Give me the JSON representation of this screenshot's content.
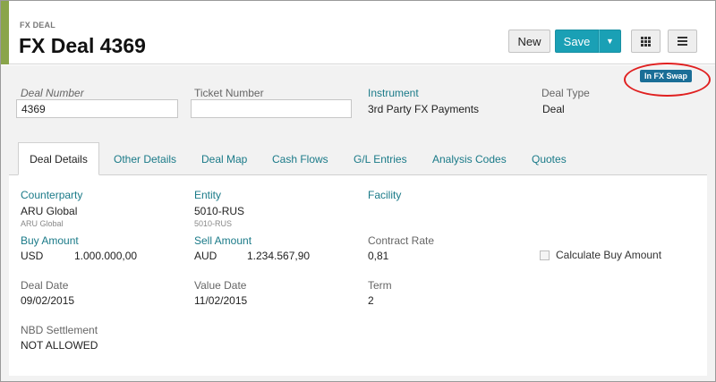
{
  "header": {
    "eyebrow": "FX DEAL",
    "title": "FX Deal 4369",
    "new_label": "New",
    "save_label": "Save"
  },
  "badge": "In FX Swap",
  "top_fields": {
    "deal_number": {
      "label": "Deal Number",
      "value": "4369"
    },
    "ticket_number": {
      "label": "Ticket Number",
      "value": ""
    },
    "instrument": {
      "label": "Instrument",
      "value": "3rd Party FX Payments"
    },
    "deal_type": {
      "label": "Deal Type",
      "value": "Deal"
    }
  },
  "tabs": [
    "Deal Details",
    "Other Details",
    "Deal Map",
    "Cash Flows",
    "G/L Entries",
    "Analysis Codes",
    "Quotes"
  ],
  "details": {
    "counterparty": {
      "label": "Counterparty",
      "value": "ARU Global",
      "sub": "ARU Global"
    },
    "entity": {
      "label": "Entity",
      "value": "5010-RUS",
      "sub": "5010-RUS"
    },
    "facility": {
      "label": "Facility"
    },
    "buy_amount": {
      "label": "Buy Amount",
      "currency": "USD",
      "amount": "1.000.000,00"
    },
    "sell_amount": {
      "label": "Sell Amount",
      "currency": "AUD",
      "amount": "1.234.567,90"
    },
    "contract_rate": {
      "label": "Contract Rate",
      "value": "0,81"
    },
    "calculate_buy_amount": {
      "label": "Calculate Buy Amount",
      "checked": false
    },
    "deal_date": {
      "label": "Deal Date",
      "value": "09/02/2015"
    },
    "value_date": {
      "label": "Value Date",
      "value": "11/02/2015"
    },
    "term": {
      "label": "Term",
      "value": "2"
    },
    "nbd_settlement": {
      "label": "NBD Settlement",
      "value": "NOT ALLOWED"
    }
  },
  "colors": {
    "accent": "#8aa54b",
    "primary": "#1aa0b5",
    "link": "#1a7a88",
    "badge": "#1a6e97",
    "highlight_ring": "#e02020"
  }
}
